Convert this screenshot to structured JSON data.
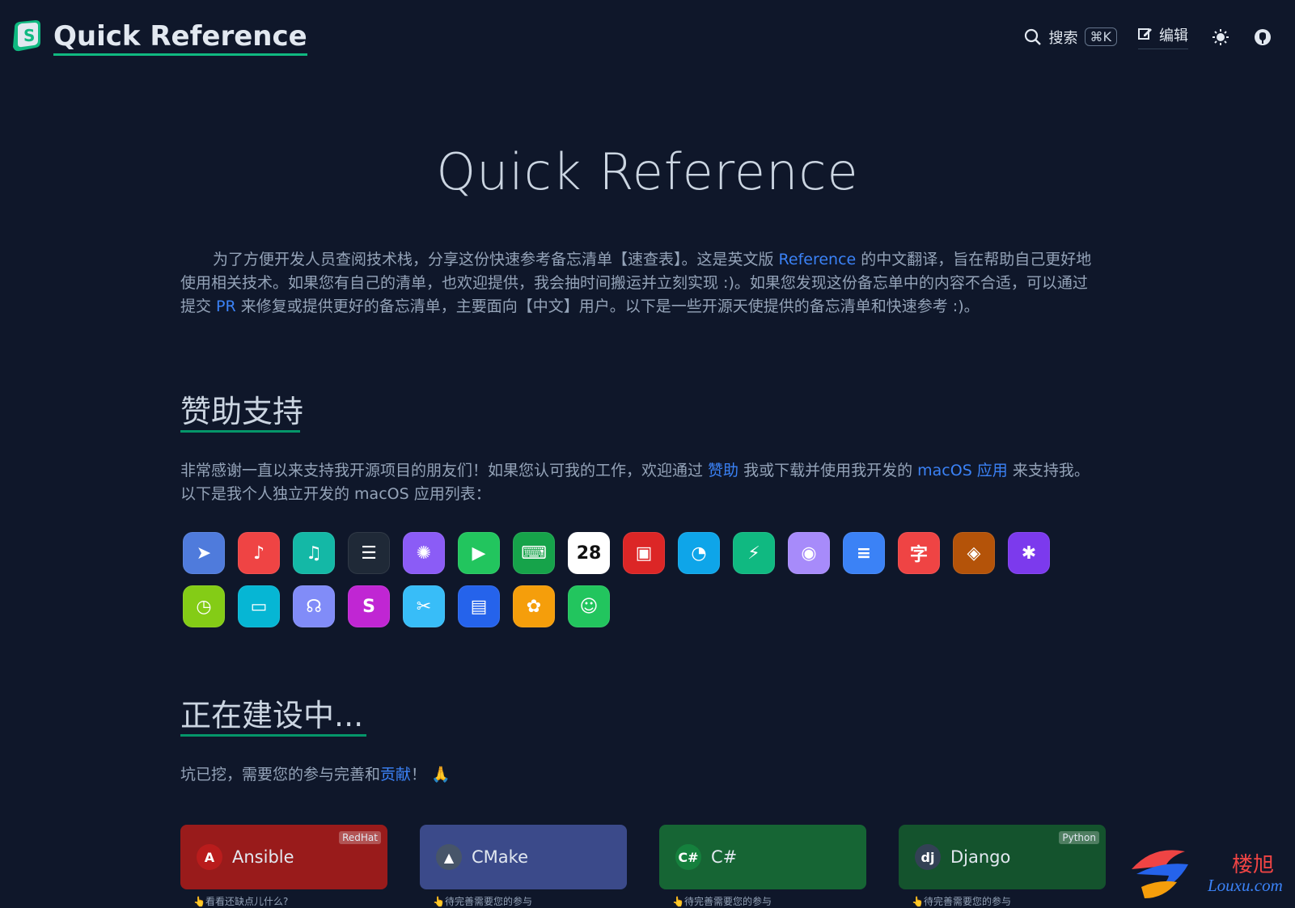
{
  "header": {
    "brand": "Quick Reference",
    "search_label": "搜索",
    "search_shortcut": "⌘K",
    "edit_label": "编辑"
  },
  "hero": {
    "title": "Quick Reference"
  },
  "intro": {
    "part1": "为了方便开发人员查阅技术栈，分享这份快速参考备忘清单【速查表】。这是英文版 ",
    "link1": "Reference",
    "part2": " 的中文翻译，旨在帮助自己更好地使用相关技术。如果您有自己的清单，也欢迎提供，我会抽时间搬运并立刻实现 :)。如果您发现这份备忘单中的内容不合适，可以通过提交 ",
    "link2": "PR",
    "part3": " 来修复或提供更好的备忘清单，主要面向【中文】用户。以下是一些开源天使提供的备忘清单和快速参考 :)。"
  },
  "sponsor": {
    "title": "赞助支持",
    "part1": "非常感谢一直以来支持我开源项目的朋友们！如果您认可我的工作，欢迎通过 ",
    "link1": "赞助",
    "part2": " 我或下载并使用我开发的 ",
    "link2": "macOS 应用",
    "part3": " 来支持我。以下是我个人独立开发的 macOS 应用列表："
  },
  "apps": [
    {
      "name": "cursor-app-icon",
      "glyph": "➤",
      "bg": "#4f7bdc"
    },
    {
      "name": "music-app-icon",
      "glyph": "♪",
      "bg": "#ef4444"
    },
    {
      "name": "music-player-app-icon",
      "glyph": "♫",
      "bg": "#14b8a6"
    },
    {
      "name": "terminal-app-icon",
      "glyph": "☰",
      "bg": "#1f2937"
    },
    {
      "name": "click-app-icon",
      "glyph": "✺",
      "bg": "#8b5cf6"
    },
    {
      "name": "play-app-icon",
      "glyph": "▶",
      "bg": "#22c55e"
    },
    {
      "name": "keyboard-app-icon",
      "glyph": "⌨",
      "bg": "#16a34a"
    },
    {
      "name": "calendar-app-icon",
      "glyph": "28",
      "bg": "#ffffff"
    },
    {
      "name": "image-app-icon",
      "glyph": "▣",
      "bg": "#dc2626"
    },
    {
      "name": "edge-app-icon",
      "glyph": "◔",
      "bg": "#0ea5e9"
    },
    {
      "name": "battery-app-icon",
      "glyph": "⚡",
      "bg": "#10b981"
    },
    {
      "name": "rss-app-icon",
      "glyph": "◉",
      "bg": "#a78bfa"
    },
    {
      "name": "list-app-icon",
      "glyph": "≡",
      "bg": "#3b82f6"
    },
    {
      "name": "char-app-icon",
      "glyph": "字",
      "bg": "#ef4444"
    },
    {
      "name": "bird-app-icon",
      "glyph": "◈",
      "bg": "#b45309"
    },
    {
      "name": "color-app-icon",
      "glyph": "✱",
      "bg": "#7c3aed"
    },
    {
      "name": "timer-app-icon",
      "glyph": "◷",
      "bg": "#84cc16"
    },
    {
      "name": "window-app-icon",
      "glyph": "▭",
      "bg": "#06b6d4"
    },
    {
      "name": "voice-app-icon",
      "glyph": "☊",
      "bg": "#818cf8"
    },
    {
      "name": "s-app-icon",
      "glyph": "S",
      "bg": "#c026d3"
    },
    {
      "name": "tools-app-icon",
      "glyph": "✂",
      "bg": "#38bdf8"
    },
    {
      "name": "doc-app-icon",
      "glyph": "▤",
      "bg": "#2563eb"
    },
    {
      "name": "art-app-icon",
      "glyph": "✿",
      "bg": "#f59e0b"
    },
    {
      "name": "smile-app-icon",
      "glyph": "☺",
      "bg": "#22c55e"
    }
  ],
  "building": {
    "title": "正在建设中...",
    "part1": "坑已挖，需要您的参与完善和",
    "link1": "贡献",
    "part2": "！ 🙏"
  },
  "cards": [
    {
      "label": "Ansible",
      "tag": "RedHat",
      "hint": "👆看看还缺点儿什么?",
      "bg": "#991b1b",
      "icon": "A",
      "icon_bg": "#b91c1c"
    },
    {
      "label": "CMake",
      "tag": "",
      "hint": "👆待完善需要您的参与",
      "bg": "#3b4a8a",
      "icon": "▲",
      "icon_bg": "#475569"
    },
    {
      "label": "C#",
      "tag": "",
      "hint": "👆待完善需要您的参与",
      "bg": "#166534",
      "icon": "C#",
      "icon_bg": "#15803d"
    },
    {
      "label": "Django",
      "tag": "Python",
      "hint": "👆待完善需要您的参与",
      "bg": "#14532d",
      "icon": "dj",
      "icon_bg": "#334155"
    }
  ],
  "watermark": {
    "cn": "楼旭",
    "en": "Louxu.com"
  }
}
